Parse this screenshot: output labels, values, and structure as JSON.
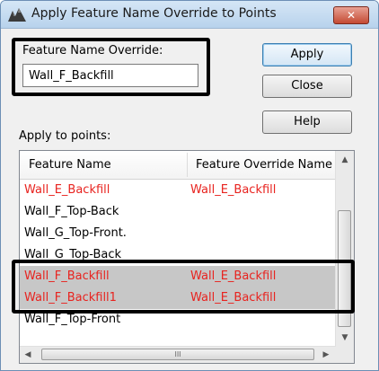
{
  "dialog": {
    "title": "Apply Feature Name Override to Points",
    "close_glyph": "✕"
  },
  "form": {
    "feature_name_override_label": "Feature Name Override:",
    "feature_name_override_value": "Wall_F_Backfill",
    "apply_to_points_label": "Apply to points:"
  },
  "buttons": {
    "apply": "Apply",
    "close": "Close",
    "help": "Help"
  },
  "list": {
    "columns": [
      "Feature Name",
      "Feature Override Name"
    ],
    "rows": [
      {
        "feature_name": "Wall_E_Backfill",
        "override": "Wall_E_Backfill",
        "color": "#e8231f"
      },
      {
        "feature_name": "Wall_F_Top-Back",
        "override": "",
        "color": "#000000"
      },
      {
        "feature_name": "Wall_G_Top-Front.",
        "override": "",
        "color": "#000000"
      },
      {
        "feature_name": "Wall_G_Top-Back",
        "override": "",
        "color": "#000000"
      },
      {
        "feature_name": "Wall_F_Backfill",
        "override": "Wall_E_Backfill",
        "color": "#e8231f"
      },
      {
        "feature_name": "Wall_F_Backfill1",
        "override": "Wall_E_Backfill",
        "color": "#e8231f"
      },
      {
        "feature_name": "Wall_F_Top-Front",
        "override": "",
        "color": "#000000"
      }
    ],
    "selected_rows": [
      4,
      5
    ],
    "scrollbar": {
      "up_icon": "▲",
      "down_icon": "▼",
      "left_icon": "◀",
      "right_icon": "▶",
      "grip": "III"
    }
  }
}
